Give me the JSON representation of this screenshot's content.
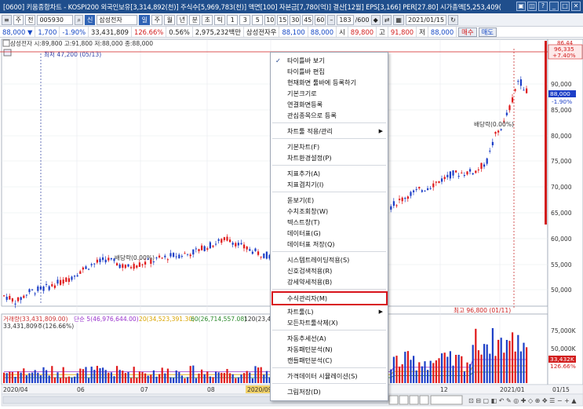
{
  "titlebar": {
    "text": "[0600] 키움종합차트 - KOSPI200 외국인보유[3,314,892(천)] 주식수[5,969,783(천)] 액면[100] 자본금[7,780(억)] 결산[12월] EPS[3,166] PER[27.80] 시가총액[5,253,409(",
    "controls": [
      "▣",
      "◫",
      "?",
      "_",
      "□",
      "✕"
    ]
  },
  "toolbar": {
    "period_select": "주",
    "all_select": "전",
    "code": "005930",
    "stock_name": "삼성전자",
    "ka_label": "신",
    "period_tabs": [
      "일",
      "주",
      "월",
      "년",
      "분",
      "초",
      "틱"
    ],
    "active_period": "일",
    "minute_options": [
      "1",
      "3",
      "5",
      "10",
      "15",
      "30",
      "45",
      "60"
    ],
    "count": "183",
    "count_total": "/600",
    "date": "2021/01/15"
  },
  "quote": {
    "price": "88,000 ▼",
    "change": "1,700",
    "change_pct": "-1.90%",
    "volume": "33,431,809",
    "volume_pct": "126.66%",
    "turnover": "0.56%",
    "amount": "2,975,232백만",
    "preferred_label": "삼성전자우",
    "pref_price": "88,100",
    "pref_price2": "88,000",
    "open_label": "시",
    "open": "89,800",
    "high_label": "고",
    "high": "91,800",
    "low_label": "저",
    "low": "88,000",
    "buy_button": "매수",
    "sell_button": "매도"
  },
  "chart": {
    "legend": "삼성전자 시:89,800 고:91,800 저:88,000 종:88,000",
    "low_annotation": "최저 47,200 (05/13)",
    "high_annotation": "최고 96,800 (01/11)",
    "dividend_label_1": "배당락(0.00%)",
    "dividend_label_2": "배당락(0.00%)",
    "price_axis": [
      "90,000",
      "85,000",
      "80,000",
      "75,000",
      "70,000",
      "65,000",
      "60,000",
      "55,000",
      "50,000"
    ],
    "price_marker_top": "96,335",
    "price_marker_top_pct": "+7.40%",
    "top_marker_label": "86.44",
    "current_marker": "88,000",
    "current_marker_pct": "-1.90%",
    "volume_legend": {
      "main": "거래량(33,431,809.00)",
      "simple": "단순 5(46,976,644.00)",
      "ma20": "20(34,523,391.30)",
      "ma60": "60(26,714,557.08)",
      "ma120": "120(23,43",
      "sub": "33,431,809주(126.66%)"
    },
    "volume_axis": [
      "75,000K",
      "50,000K"
    ],
    "volume_marker": "33,432K",
    "volume_marker_pct": "126.66%",
    "time_axis": [
      "2020/04",
      "06",
      "07",
      "08",
      "2020/09",
      "12",
      "2021/01",
      "01/15"
    ]
  },
  "context_menu": {
    "items": [
      {
        "label": "타이틀바 보기",
        "checked": true
      },
      {
        "label": "타이틀바 편집"
      },
      {
        "label": "현재화면 툴바에 등록하기"
      },
      {
        "label": "기본크기로"
      },
      {
        "label": "연결화면등록"
      },
      {
        "label": "관심종목으로 등록"
      },
      {
        "label": "차트툴 적용/관리",
        "submenu": true
      },
      {
        "label": "기본차트(F)"
      },
      {
        "label": "차트환경설정(P)"
      },
      {
        "label": "지표추가(A)"
      },
      {
        "label": "지표겹치기(I)"
      },
      {
        "label": "돋보기(E)"
      },
      {
        "label": "수치조회창(W)"
      },
      {
        "label": "텍스트창(T)"
      },
      {
        "label": "데이터표(G)"
      },
      {
        "label": "데이터표 저장(Q)"
      },
      {
        "label": "시스템트레이딩적용(S)"
      },
      {
        "label": "신호검색적용(R)"
      },
      {
        "label": "강세약세적용(B)"
      },
      {
        "label": "수식관리자(M)",
        "highlighted": true
      },
      {
        "label": "차트툴(L)",
        "submenu": true
      },
      {
        "label": "모든차트툴삭제(X)"
      },
      {
        "label": "자동추세선(A)"
      },
      {
        "label": "자동패턴분석(N)"
      },
      {
        "label": "캔들패턴분석(C)"
      },
      {
        "label": "가격데이터 시뮬레이션(S)"
      },
      {
        "label": "그림저장(D)"
      }
    ]
  },
  "colors": {
    "up": "#e0191b",
    "down": "#1d3fc7",
    "titlebar": "#1f4e8c",
    "highlight_box": "#d8141c"
  }
}
